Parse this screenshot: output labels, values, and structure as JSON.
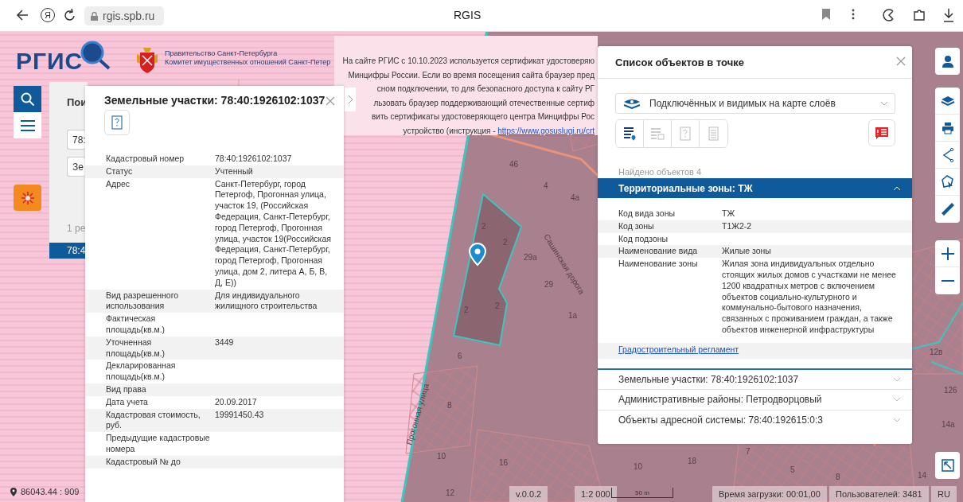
{
  "browser": {
    "home_glyph": "Я",
    "url": "rgis.spb.ru",
    "title": "RGIS"
  },
  "header": {
    "logo": "РГИС",
    "gov_lines": [
      "Правительство Санкт-Петербурга",
      "Комитет имущественных отношений Санкт-Петер"
    ]
  },
  "notice": {
    "lines": [
      "На сайте РГИС с 10.10.2023 используется сертификат удостоверяю",
      "Минцифры России. Если во время посещения сайта браузер пред",
      "сном подключении, то для безопасного доступа к сайту РГ",
      "льзовать браузер поддерживающий отечественные сертиф",
      "вить сертификаты удостоверяющего центра Минцифры Рос",
      "устройство (инструкция - "
    ],
    "link": "https://www.gosuslugi.ru/crt"
  },
  "left_toolbar": [
    {
      "kind": "search",
      "selected": true
    },
    {
      "kind": "menu",
      "selected": false
    },
    {
      "kind": "emblem"
    }
  ],
  "search_panel": {
    "title": "Пои",
    "input": "78:",
    "select": "Зе",
    "count": "1 ре",
    "result": "78:4"
  },
  "parcel_popup": {
    "title": "Земельные участки: 78:40:1926102:1037",
    "rows": [
      {
        "label": "Кадастровый номер",
        "value": "78:40:1926102:1037"
      },
      {
        "label": "Статус",
        "value": "Учтенный"
      },
      {
        "label": "Адрес",
        "value": "Санкт-Петербург, город Петергоф, Прогонная улица, участок 19, (Российская Федерация, Санкт-Петербург, город Петергоф, Прогонная улица, участок 19(Российская Федерация, Санкт-Петербург, город Петергоф, Прогонная улица, дом 2, литера А, Б, В, Д, Е))"
      },
      {
        "label": "Вид разрешенного использования",
        "value": "Для индивидуального жилищного строительства"
      },
      {
        "label": "Фактическая площадь(кв.м.)"
      },
      {
        "label": "Уточненная площадь(кв.м.)",
        "value": "3449"
      },
      {
        "label": "Декларированная площадь(кв.м.)"
      },
      {
        "label": "Вид права"
      },
      {
        "label": "Дата учета",
        "value": "20.09.2017"
      },
      {
        "label": "Кадастровая стоимость, руб.",
        "value": "19991450.43"
      },
      {
        "label": "Предыдущие кадастровые номера"
      },
      {
        "label": "Кадастровый № до"
      }
    ]
  },
  "objects_popup": {
    "title": "Список объектов в точке",
    "layer_filter": "Подключённых и видимых на карте слоёв",
    "tools": [
      {
        "kind": "list-pin",
        "disabled": false
      },
      {
        "kind": "list-box",
        "disabled": true
      },
      {
        "kind": "question-frame",
        "disabled": true
      },
      {
        "kind": "document",
        "disabled": true
      }
    ],
    "found": "Найдено объектов 4",
    "sections": [
      {
        "title": "Территориальные зоны: ТЖ",
        "expanded": true,
        "rows": [
          {
            "label": "Код вида зоны",
            "value": "ТЖ"
          },
          {
            "label": "Код зоны",
            "value": "Т1Ж2-2"
          },
          {
            "label": "Код подзоны"
          },
          {
            "label": "Наименование вида",
            "value": "Жилые зоны"
          },
          {
            "label": "Наименование зоны",
            "value": "Жилая зона индивидуальных отдельно стоящих жилых домов с участками не менее 1200 квадратных метров с включением объектов социально-культурного и коммунально-бытового назначения, связанных с проживанием граждан, а также объектов инженерной инфраструктуры"
          }
        ],
        "link": "Градостроительный регламент"
      },
      {
        "title": "Земельные участки: 78:40:1926102:1037",
        "expanded": false
      },
      {
        "title": "Административные районы: Петродворцовый",
        "expanded": false
      },
      {
        "title": "Объекты адресной системы: 78:40:192615:0:3",
        "expanded": false
      }
    ]
  },
  "map": {
    "labels": [
      "46",
      "4",
      "4а",
      "2",
      "2",
      "2",
      "2",
      "29а",
      "29",
      "1а",
      "6",
      "8",
      "10",
      "16",
      "12",
      "12в",
      "126",
      "14а",
      "18",
      "7",
      "10",
      "5",
      "8",
      "14"
    ],
    "streets": [
      "Сашинская дорога",
      "Прогонная улица"
    ]
  },
  "status_bar": {
    "coordinates": "86043.44 : 909",
    "version": "v.0.0.2",
    "scale": "1:2 000",
    "scale_bar": "50 m",
    "load_time": "Время загрузки: 00:01,00",
    "users": "Пользователей: 3481",
    "language": "RU"
  }
}
